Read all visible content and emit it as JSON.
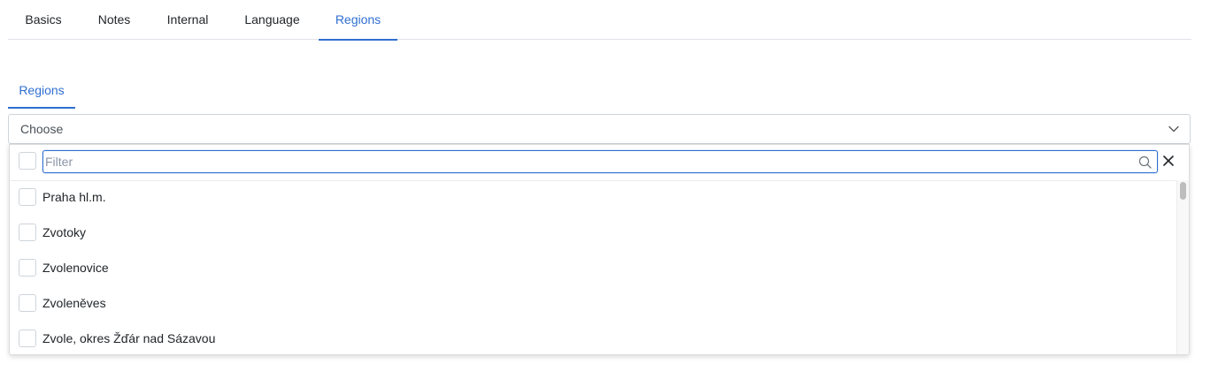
{
  "tabs": [
    {
      "label": "Basics",
      "active": false
    },
    {
      "label": "Notes",
      "active": false
    },
    {
      "label": "Internal",
      "active": false
    },
    {
      "label": "Language",
      "active": false
    },
    {
      "label": "Regions",
      "active": true
    }
  ],
  "section_tab": {
    "label": "Regions"
  },
  "select": {
    "value": "Choose",
    "icon": "chevron-down-icon"
  },
  "filter": {
    "placeholder": "Filter",
    "value": "",
    "search_icon": "search-icon",
    "close_icon": "close-icon"
  },
  "options": [
    {
      "label": "Praha hl.m.",
      "checked": false
    },
    {
      "label": "Zvotoky",
      "checked": false
    },
    {
      "label": "Zvolenovice",
      "checked": false
    },
    {
      "label": "Zvoleněves",
      "checked": false
    },
    {
      "label": "Zvole, okres Žďár nad Sázavou",
      "checked": false
    }
  ],
  "colors": {
    "accent": "#2f6fd1",
    "border": "#ced4da",
    "text": "#212529"
  }
}
